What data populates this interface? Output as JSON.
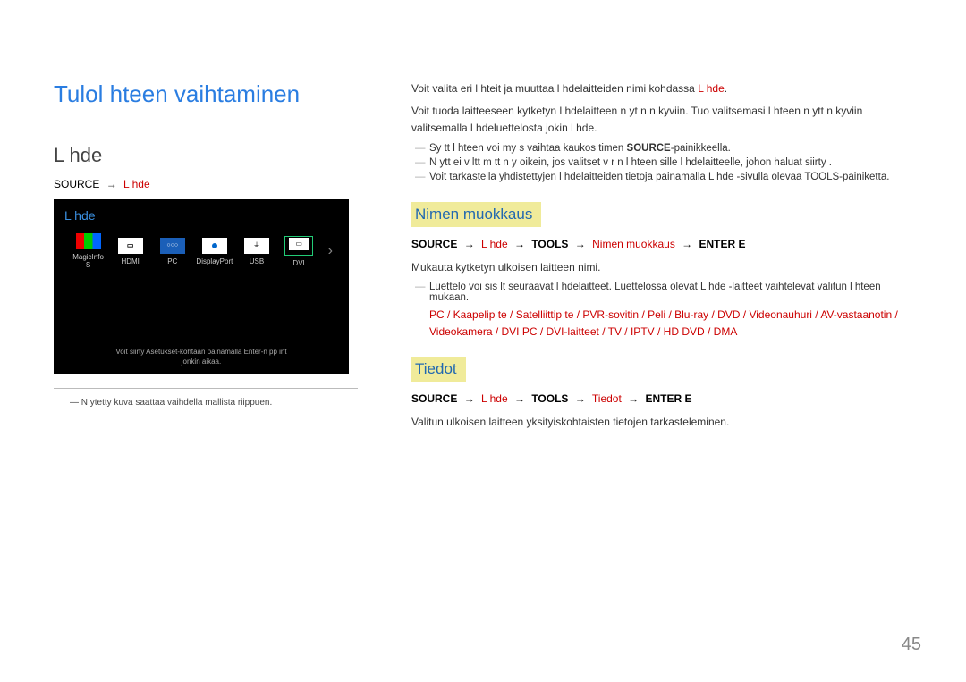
{
  "page": {
    "number": "45",
    "main_title": "Tulol hteen vaihtaminen",
    "left": {
      "heading": "L hde",
      "path_source": "SOURCE",
      "path_end": "L hde",
      "screenshot": {
        "title": "L hde",
        "sources": {
          "magic": "MagicInfo S",
          "hdmi": "HDMI",
          "pc": "PC",
          "dp": "DisplayPort",
          "usb": "USB",
          "dvi": "DVI"
        },
        "bottom1": "Voit siirty  Asetukset-kohtaan painamalla Enter-n pp int",
        "bottom2": "jonkin aikaa."
      },
      "note": "N ytetty kuva saattaa vaihdella mallista riippuen."
    },
    "right": {
      "intro1_a": "Voit valita eri l hteit  ja muuttaa l hdelaitteiden nimi  kohdassa ",
      "intro1_b": "L hde",
      "intro1_c": ".",
      "intro2": "Voit tuoda laitteeseen kytketyn l hdelaitteen n yt n n kyviin. Tuo valitsemasi l hteen n ytt  n kyviin valitsemalla l hdeluettelosta jokin l hde.",
      "dash1_a": "Sy tt l hteen voi my s vaihtaa kaukos  timen ",
      "dash1_b": "SOURCE",
      "dash1_c": "-painikkeella.",
      "dash2": "N ytt  ei v ltt m tt  n y oikein, jos valitset v  r n l hteen sille l hdelaitteelle, johon haluat siirty .",
      "dash3_a": "Voit tarkastella yhdistettyjen l hdelaitteiden tietoja painamalla ",
      "dash3_b": "L hde",
      "dash3_c": " -sivulla olevaa TOOLS-painiketta.",
      "nimen": {
        "header": "Nimen muokkaus",
        "path_source": "SOURCE",
        "path_lahde": "L hde",
        "path_tools": "TOOLS",
        "path_nimen": "Nimen muokkaus",
        "path_enter": "ENTER E",
        "line1": "Mukauta kytketyn ulkoisen laitteen nimi.",
        "dash_a": "Luettelo voi sis lt   seuraavat l hdelaitteet. Luettelossa olevat ",
        "dash_b": "L hde",
        "dash_c": " -laitteet vaihtelevat valitun l hteen mukaan.",
        "devices": "PC / Kaapelip  te   / Satelliittip  te    / PVR-sovitin / Peli / Blu-ray / DVD / Videonauhuri / AV-vastaanotin / Videokamera / DVI PC / DVI-laitteet /  TV / IPTV / HD DVD / DMA"
      },
      "tiedot": {
        "header": "Tiedot",
        "path_source": "SOURCE",
        "path_lahde": "L hde",
        "path_tools": "TOOLS",
        "path_tiedot": "Tiedot",
        "path_enter": "ENTER E",
        "line1": "Valitun ulkoisen laitteen yksityiskohtaisten tietojen tarkasteleminen."
      }
    }
  }
}
